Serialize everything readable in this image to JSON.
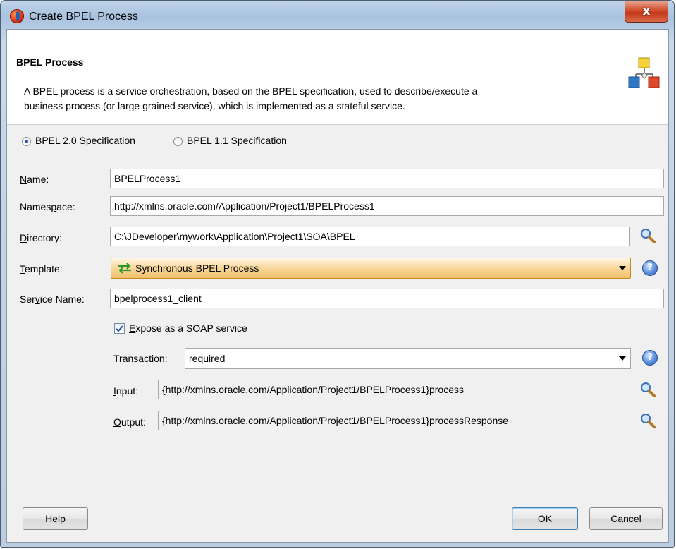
{
  "window": {
    "title": "Create BPEL Process",
    "close_label": "x"
  },
  "header": {
    "title": "BPEL Process",
    "description_line1": "A BPEL process is a service orchestration, based on the BPEL specification, used to describe/execute a",
    "description_line2": "business process (or large grained service), which is implemented as a stateful service."
  },
  "spec": {
    "options": [
      {
        "label": "BPEL 2.0 Specification",
        "selected": true
      },
      {
        "label": "BPEL 1.1 Specification",
        "selected": false
      }
    ]
  },
  "form": {
    "name": {
      "label_u": "N",
      "label_rest": "ame:",
      "value": "BPELProcess1"
    },
    "namespace": {
      "label_a": "Names",
      "label_u": "p",
      "label_b": "ace:",
      "value": "http://xmlns.oracle.com/Application/Project1/BPELProcess1"
    },
    "directory": {
      "label_u": "D",
      "label_rest": "irectory:",
      "value": "C:\\JDeveloper\\mywork\\Application\\Project1\\SOA\\BPEL"
    },
    "template": {
      "label_u": "T",
      "label_rest": "emplate:",
      "value": "Synchronous BPEL Process"
    },
    "service_name": {
      "label_a": "Ser",
      "label_u": "v",
      "label_b": "ice Name:",
      "value": "bpelprocess1_client"
    },
    "expose": {
      "label_u": "E",
      "label_rest": "xpose as a SOAP service",
      "checked": true
    },
    "transaction": {
      "label_a": "T",
      "label_u": "r",
      "label_b": "ansaction:",
      "value": "required"
    },
    "input": {
      "label_u": "I",
      "label_rest": "nput:",
      "value": "{http://xmlns.oracle.com/Application/Project1/BPELProcess1}process"
    },
    "output": {
      "label_u": "O",
      "label_rest": "utput:",
      "value": "{http://xmlns.oracle.com/Application/Project1/BPELProcess1}processResponse"
    }
  },
  "buttons": {
    "help": "Help",
    "ok": "OK",
    "cancel": "Cancel"
  },
  "icons": {
    "app": "jdeveloper-icon",
    "header": "bpel-process-icon",
    "browse": "magnifier-icon",
    "help": "help-icon",
    "template": "synchronous-arrows-icon"
  },
  "colors": {
    "template_bg": "#f8d79a",
    "help_blue": "#2e5fb5",
    "ok_border": "#3c7fb1"
  }
}
